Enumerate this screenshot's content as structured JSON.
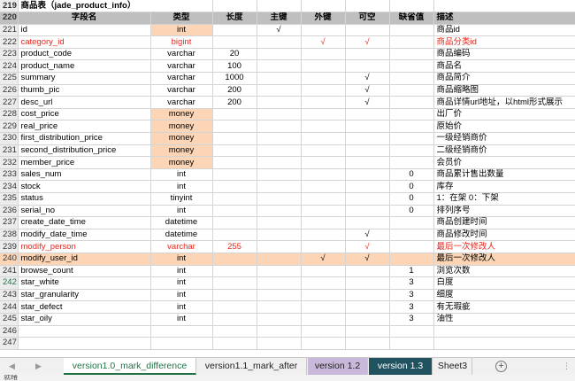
{
  "sheet": {
    "title_row": {
      "row": "219",
      "text": "商品表（jade_product_info）"
    },
    "header": {
      "row": "220",
      "cols": [
        "字段名",
        "类型",
        "长度",
        "主键",
        "外键",
        "可空",
        "缺省值",
        "描述"
      ]
    },
    "rows": [
      {
        "row": "221",
        "name": "id",
        "type": "int",
        "len": "",
        "pk": "√",
        "fk": "",
        "nullable": "",
        "def": "",
        "desc": "商品id",
        "peach_type": true
      },
      {
        "row": "222",
        "name": "category_id",
        "type": "bigint",
        "len": "",
        "pk": "",
        "fk": "√",
        "nullable": "√",
        "def": "",
        "desc": "商品分类id",
        "style": "red"
      },
      {
        "row": "223",
        "name": "product_code",
        "type": "varchar",
        "len": "20",
        "pk": "",
        "fk": "",
        "nullable": "",
        "def": "",
        "desc": "商品编码"
      },
      {
        "row": "224",
        "name": "product_name",
        "type": "varchar",
        "len": "100",
        "pk": "",
        "fk": "",
        "nullable": "",
        "def": "",
        "desc": "商品名"
      },
      {
        "row": "225",
        "name": "summary",
        "type": "varchar",
        "len": "1000",
        "pk": "",
        "fk": "",
        "nullable": "√",
        "def": "",
        "desc": "商品简介"
      },
      {
        "row": "226",
        "name": "thumb_pic",
        "type": "varchar",
        "len": "200",
        "pk": "",
        "fk": "",
        "nullable": "√",
        "def": "",
        "desc": "商品缩略图"
      },
      {
        "row": "227",
        "name": "desc_url",
        "type": "varchar",
        "len": "200",
        "pk": "",
        "fk": "",
        "nullable": "√",
        "def": "",
        "desc": "商品详情url地址，以html形式展示"
      },
      {
        "row": "228",
        "name": "cost_price",
        "type": "money",
        "len": "",
        "pk": "",
        "fk": "",
        "nullable": "",
        "def": "",
        "desc": "出厂价",
        "peach_type": true
      },
      {
        "row": "229",
        "name": "real_price",
        "type": "money",
        "len": "",
        "pk": "",
        "fk": "",
        "nullable": "",
        "def": "",
        "desc": "原始价",
        "peach_type": true
      },
      {
        "row": "230",
        "name": "first_distribution_price",
        "type": "money",
        "len": "",
        "pk": "",
        "fk": "",
        "nullable": "",
        "def": "",
        "desc": "一级经销商价",
        "peach_type": true
      },
      {
        "row": "231",
        "name": "second_distribution_price",
        "type": "money",
        "len": "",
        "pk": "",
        "fk": "",
        "nullable": "",
        "def": "",
        "desc": "二级经销商价",
        "peach_type": true
      },
      {
        "row": "232",
        "name": "member_price",
        "type": "money",
        "len": "",
        "pk": "",
        "fk": "",
        "nullable": "",
        "def": "",
        "desc": "会员价",
        "peach_type": true
      },
      {
        "row": "233",
        "name": "sales_num",
        "type": "int",
        "len": "",
        "pk": "",
        "fk": "",
        "nullable": "",
        "def": "0",
        "desc": "商品累计售出数量"
      },
      {
        "row": "234",
        "name": "stock",
        "type": "int",
        "len": "",
        "pk": "",
        "fk": "",
        "nullable": "",
        "def": "0",
        "desc": "库存"
      },
      {
        "row": "235",
        "name": "status",
        "type": "tinyint",
        "len": "",
        "pk": "",
        "fk": "",
        "nullable": "",
        "def": "0",
        "desc": "1：在架 0：下架"
      },
      {
        "row": "236",
        "name": "serial_no",
        "type": "int",
        "len": "",
        "pk": "",
        "fk": "",
        "nullable": "",
        "def": "0",
        "desc": "排列序号"
      },
      {
        "row": "237",
        "name": "create_date_time",
        "type": "datetime",
        "len": "",
        "pk": "",
        "fk": "",
        "nullable": "",
        "def": "",
        "desc": "商品创建时间"
      },
      {
        "row": "238",
        "name": "modify_date_time",
        "type": "datetime",
        "len": "",
        "pk": "",
        "fk": "",
        "nullable": "√",
        "def": "",
        "desc": "商品修改时间"
      },
      {
        "row": "239",
        "name": "modify_person",
        "type": "varchar",
        "len": "255",
        "pk": "",
        "fk": "",
        "nullable": "√",
        "def": "",
        "desc": "最后一次修改人",
        "style": "red"
      },
      {
        "row": "240",
        "name": "modify_user_id",
        "type": "int",
        "len": "",
        "pk": "",
        "fk": "√",
        "nullable": "√",
        "def": "",
        "desc": "最后一次修改人",
        "style": "hl"
      },
      {
        "row": "241",
        "name": "browse_count",
        "type": "int",
        "len": "",
        "pk": "",
        "fk": "",
        "nullable": "",
        "def": "1",
        "desc": "浏览次数"
      },
      {
        "row": "242",
        "name": "star_white",
        "type": "int",
        "len": "",
        "pk": "",
        "fk": "",
        "nullable": "",
        "def": "3",
        "desc": "白度",
        "row_selected": true
      },
      {
        "row": "243",
        "name": "star_granularity",
        "type": "int",
        "len": "",
        "pk": "",
        "fk": "",
        "nullable": "",
        "def": "3",
        "desc": "细度"
      },
      {
        "row": "244",
        "name": "star_defect",
        "type": "int",
        "len": "",
        "pk": "",
        "fk": "",
        "nullable": "",
        "def": "3",
        "desc": "有无瑕疵"
      },
      {
        "row": "245",
        "name": "star_oily",
        "type": "int",
        "len": "",
        "pk": "",
        "fk": "",
        "nullable": "",
        "def": "3",
        "desc": "油性"
      },
      {
        "row": "246",
        "name": "",
        "type": "",
        "len": "",
        "pk": "",
        "fk": "",
        "nullable": "",
        "def": "",
        "desc": ""
      },
      {
        "row": "247",
        "name": "",
        "type": "",
        "len": "",
        "pk": "",
        "fk": "",
        "nullable": "",
        "def": "",
        "desc": ""
      }
    ]
  },
  "tabs": [
    {
      "label": "version1.0_mark_difference",
      "active": true
    },
    {
      "label": "version1.1_mark_after"
    },
    {
      "label": "version 1.2"
    },
    {
      "label": "version 1.3"
    },
    {
      "label": "Sheet3"
    }
  ],
  "tab_nav": {
    "prev": "◀",
    "next": "▶",
    "add": "+",
    "more": "⋮"
  },
  "status_bar": {
    "text": "就绪"
  },
  "colors": {
    "header_bg": "#bfbfbf",
    "peach": "#fbd5b5",
    "red_text": "#e8261b",
    "active_tab": "#217346",
    "tab_v12": "#c9b8d9",
    "tab_v13": "#20535f"
  }
}
